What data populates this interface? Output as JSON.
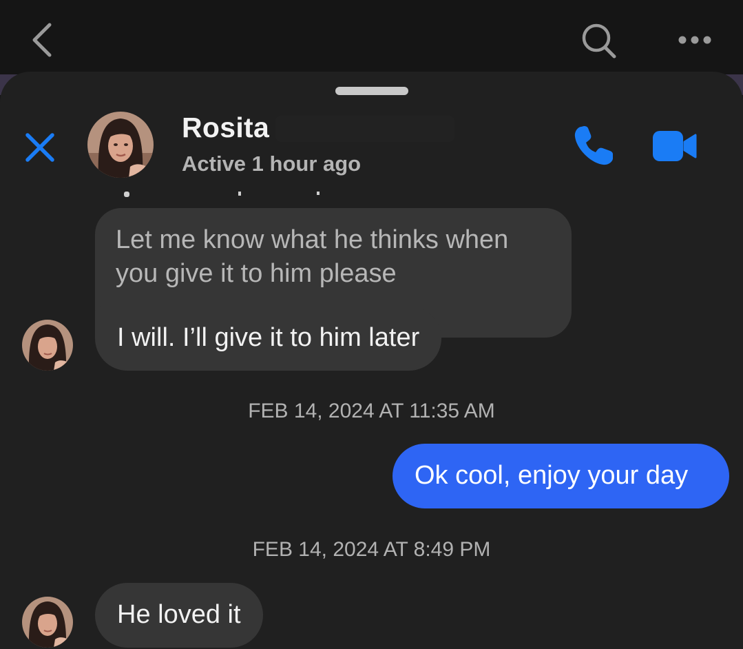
{
  "contact": {
    "name": "Rosita",
    "status": "Active 1 hour ago"
  },
  "messages": [
    {
      "lines": [
        "Let me know what he thinks when",
        "you give it to him please"
      ]
    },
    {
      "text": "I will. I’ll give it to him later"
    },
    {
      "text": "Ok cool, enjoy your day"
    },
    {
      "text": "He loved it"
    }
  ],
  "timestamps": [
    "FEB 14, 2024 AT 11:35 AM",
    "FEB 14, 2024 AT 8:49 PM"
  ],
  "icons": {
    "back": "chevron-left-icon",
    "search": "search-icon",
    "more": "more-icon",
    "close": "close-icon",
    "call": "phone-icon",
    "video": "video-camera-icon"
  },
  "colors": {
    "accent": "#1877f2",
    "outgoing_bubble": "#2e65f4",
    "incoming_bubble": "#363636",
    "sheet": "#202020"
  }
}
